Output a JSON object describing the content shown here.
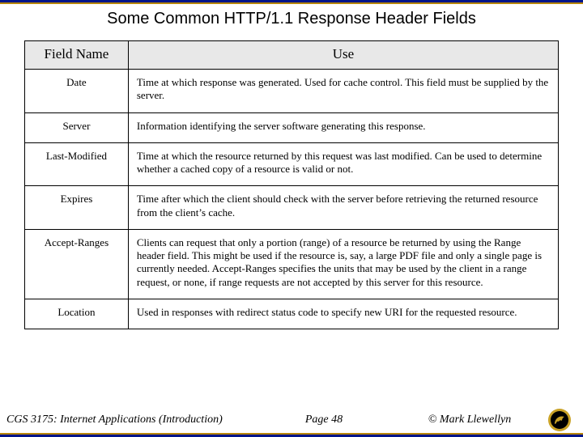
{
  "title": "Some Common HTTP/1.1 Response Header Fields",
  "headers": {
    "col1": "Field Name",
    "col2": "Use"
  },
  "rows": [
    {
      "name": "Date",
      "use": "Time at which response was generated.  Used for cache control.  This field must be supplied by the server."
    },
    {
      "name": "Server",
      "use": "Information identifying the server software generating this response."
    },
    {
      "name": "Last-Modified",
      "use": "Time at which the resource returned by this request was last modified.  Can be used to determine whether a cached copy of a resource is valid or not."
    },
    {
      "name": "Expires",
      "use": "Time after which the client should check with the server before retrieving the returned resource from the client’s cache."
    },
    {
      "name": "Accept-Ranges",
      "use": "Clients can request that only a portion (range) of a resource be returned by using the Range header field.  This might be used if the resource is, say, a large PDF file and only a single page is currently needed.  Accept-Ranges specifies the units that may be used by the client in a range request, or none, if range requests are not accepted by this server for this resource."
    },
    {
      "name": "Location",
      "use": "Used in responses with redirect status code to specify new URI for the requested resource."
    }
  ],
  "footer": {
    "course": "CGS 3175: Internet Applications (Introduction)",
    "page": "Page 48",
    "copyright": "© Mark Llewellyn"
  }
}
